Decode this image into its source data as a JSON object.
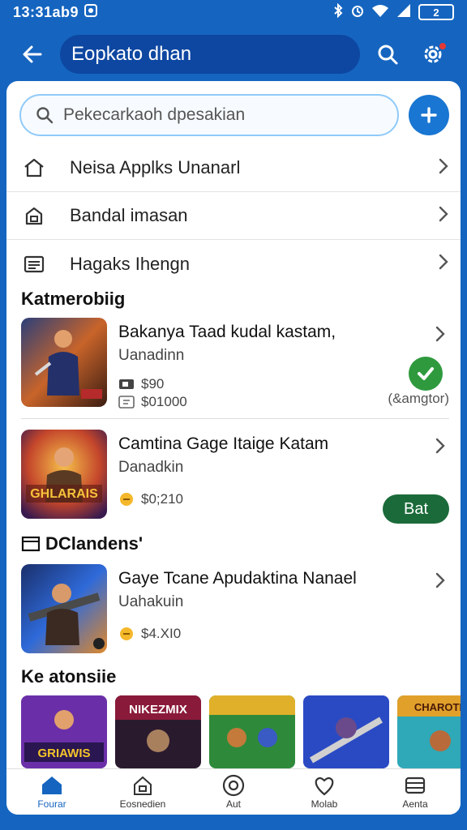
{
  "status": {
    "time": "13:31ab9",
    "battery": "2"
  },
  "appbar": {
    "title": "Eopkato dhan"
  },
  "search": {
    "placeholder": "Pekecarkaoh dpesakian"
  },
  "menu": [
    {
      "label": "Neisa Applks Unanarl",
      "icon": "home-icon"
    },
    {
      "label": "Bandal imasan",
      "icon": "bag-icon"
    },
    {
      "label": "Hagaks Ihengn",
      "icon": "list-icon"
    }
  ],
  "sections": {
    "featured": "Katmerobiig",
    "downloads": "DClandens'",
    "more": "Ke atonsiie"
  },
  "apps": [
    {
      "name": "Bakanya Taad kudal kastam,",
      "sub": "Uanadinn",
      "meta1": "$90",
      "meta2": "$01000",
      "side_note": "(&amgtor)",
      "status_icon": "check-icon"
    },
    {
      "name": "Camtina Gage Itaige Katam",
      "sub": "Danadkin",
      "meta1": "$0;210",
      "action": "Bat",
      "art_text": "GHLARAIS"
    },
    {
      "name": "Gaye Tcane Apudaktina Nanael",
      "sub": "Uahakuin",
      "meta1": "$4.XI0"
    }
  ],
  "tiles": [
    "GRIAWIS",
    "NIKEZMIX",
    "",
    "",
    "CHAROTE"
  ],
  "bottom_nav": [
    {
      "label": "Fourar",
      "icon": "home-icon",
      "active": true
    },
    {
      "label": "Eosnedien",
      "icon": "bag-icon",
      "active": false
    },
    {
      "label": "Aut",
      "icon": "target-icon",
      "active": false
    },
    {
      "label": "Molab",
      "icon": "heart-icon",
      "active": false
    },
    {
      "label": "Aenta",
      "icon": "menu-icon",
      "active": false
    }
  ],
  "colors": {
    "primary": "#1565c0",
    "accent": "#1976d2",
    "success": "#2e9a3d",
    "action": "#1b6b3a"
  }
}
